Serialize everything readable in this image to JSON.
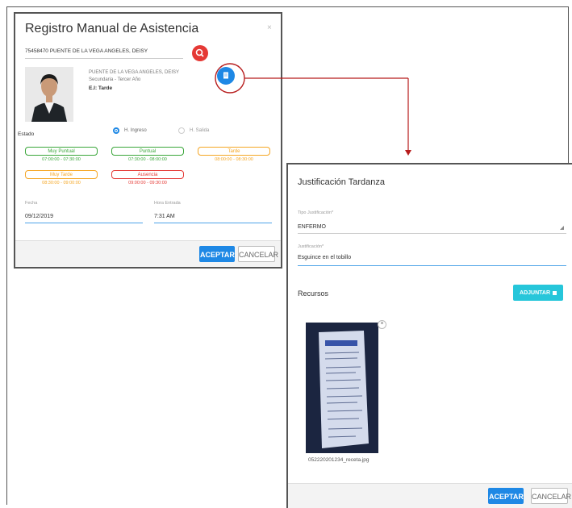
{
  "dialog1": {
    "title": "Registro Manual de Asistencia",
    "close": "×",
    "search_value": "75458470  PUENTE DE LA VEGA ANGELES, DEISY",
    "student_name": "PUENTE DE LA VEGA ANGELES, DEISY",
    "student_level": "Secundaria - Tercer Año",
    "student_status": "E.I: Tarde",
    "estado_label": "Estado",
    "radio_ingreso": "H. Ingreso",
    "radio_salida": "H. Salida",
    "options": [
      {
        "label": "Muy Puntual",
        "time": "07:00:00 - 07:30:00"
      },
      {
        "label": "Puntual",
        "time": "07:30:00 - 08:00:00"
      },
      {
        "label": "Tarde",
        "time": "08:00:00 - 08:30:00"
      },
      {
        "label": "Muy Tarde",
        "time": "08:30:00 - 09:00:00"
      },
      {
        "label": "Ausencia",
        "time": "09:00:00 - 09:30:00"
      }
    ],
    "fecha_label": "Fecha",
    "fecha_value": "09/12/2019",
    "hora_label": "Hora Entrada",
    "hora_value": "7:31 AM",
    "accept": "ACEPTAR",
    "cancel": "CANCELAR"
  },
  "dialog2": {
    "title": "Justificación Tardanza",
    "tipo_label": "Tipo Justificación*",
    "tipo_value": "ENFERMO",
    "just_label": "Justificación*",
    "just_value": "Esguince en el tobillo",
    "recursos": "Recursos",
    "adjuntar": "ADJUNTAR",
    "file_name": "052220201234_receta.jpg",
    "accept": "ACEPTAR",
    "cancel": "CANCELAR"
  },
  "colors": {
    "primary": "#1e88e5",
    "search_btn": "#e53935",
    "adjuntar": "#26c6da",
    "connector": "#b71c1c"
  }
}
